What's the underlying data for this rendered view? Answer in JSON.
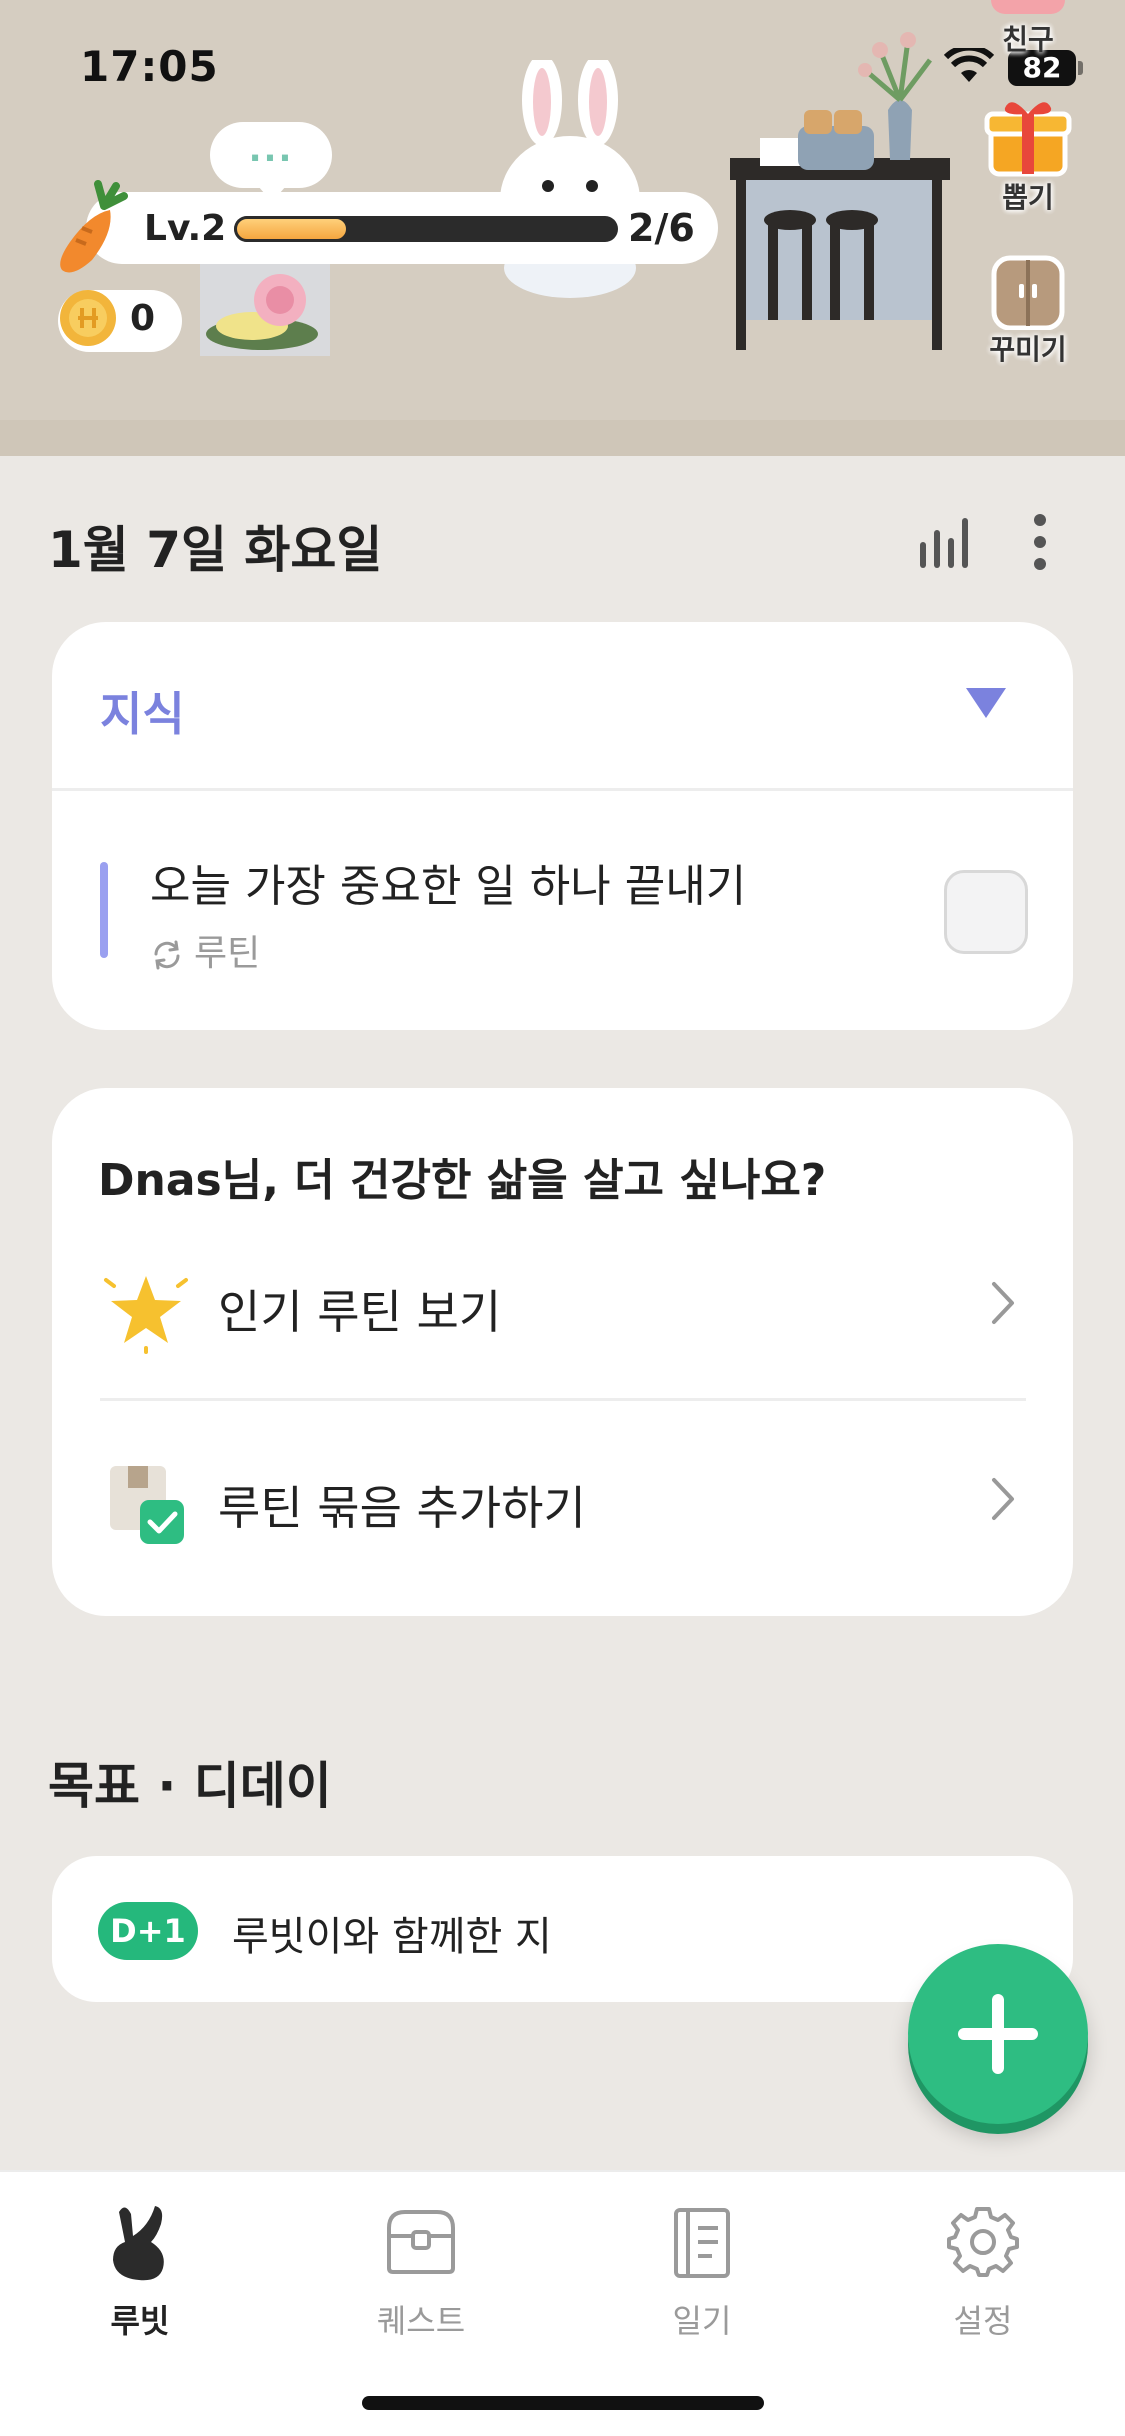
{
  "status_bar": {
    "time": "17:05",
    "battery": "82"
  },
  "header": {
    "bubble": "...",
    "level_label": "Lv.2",
    "xp_progress": "2/6",
    "xp_fraction": 0.3,
    "coins": "0",
    "side_buttons": [
      {
        "label": "친구",
        "icon": "friends-icon"
      },
      {
        "label": "뽑기",
        "icon": "gift-icon"
      },
      {
        "label": "꾸미기",
        "icon": "wardrobe-icon"
      }
    ]
  },
  "date_title": "1월 7일 화요일",
  "category": {
    "title": "지식",
    "todo": {
      "title": "오늘 가장 중요한 일 하나 끝내기",
      "tag": "루틴"
    }
  },
  "recommend": {
    "title": "Dnas님, 더 건강한 삶을 살고 싶나요?",
    "items": [
      {
        "label": "인기 루틴 보기",
        "icon": "star-icon"
      },
      {
        "label": "루틴 묶음 추가하기",
        "icon": "routine-bundle-icon"
      }
    ]
  },
  "goals": {
    "title": "목표 · 디데이",
    "items": [
      {
        "badge": "D+1",
        "text": "루빗이와 함께한 지"
      }
    ]
  },
  "tabbar": {
    "tabs": [
      {
        "label": "루빗",
        "icon": "rabbit-icon",
        "active": true
      },
      {
        "label": "퀘스트",
        "icon": "chest-icon",
        "active": false
      },
      {
        "label": "일기",
        "icon": "diary-icon",
        "active": false
      },
      {
        "label": "설정",
        "icon": "gear-icon",
        "active": false
      }
    ]
  },
  "colors": {
    "accent": "#7b82de",
    "green": "#2ebd82",
    "background": "#ebe8e4"
  }
}
